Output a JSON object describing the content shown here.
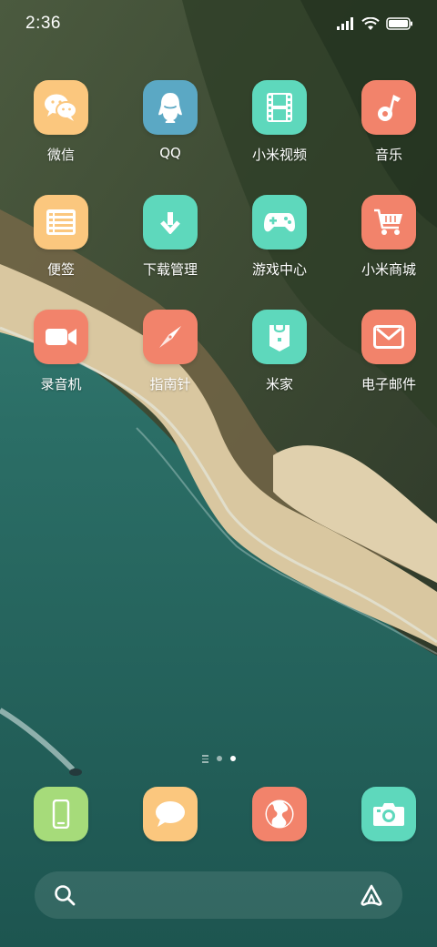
{
  "status_bar": {
    "time": "2:36",
    "icons": [
      "cellular-signal-icon",
      "wifi-icon",
      "battery-icon"
    ]
  },
  "apps": [
    [
      {
        "label": "微信",
        "icon": "wechat-icon",
        "color": "#FBC77E"
      },
      {
        "label": "QQ",
        "icon": "qq-penguin-icon",
        "color": "#5BA8C4"
      },
      {
        "label": "小米视频",
        "icon": "film-icon",
        "color": "#5ED8BC"
      },
      {
        "label": "音乐",
        "icon": "music-note-icon",
        "color": "#F2836B"
      }
    ],
    [
      {
        "label": "便签",
        "icon": "notes-list-icon",
        "color": "#FBC77E"
      },
      {
        "label": "下载管理",
        "icon": "download-arrow-icon",
        "color": "#5ED8BC"
      },
      {
        "label": "游戏中心",
        "icon": "gamepad-icon",
        "color": "#5ED8BC"
      },
      {
        "label": "小米商城",
        "icon": "shopping-cart-icon",
        "color": "#F2836B"
      }
    ],
    [
      {
        "label": "录音机",
        "icon": "recorder-icon",
        "color": "#F2836B"
      },
      {
        "label": "指南针",
        "icon": "compass-icon",
        "color": "#F2836B"
      },
      {
        "label": "米家",
        "icon": "mijia-bag-icon",
        "color": "#5ED8BC"
      },
      {
        "label": "电子邮件",
        "icon": "mail-envelope-icon",
        "color": "#F2836B"
      }
    ]
  ],
  "page_indicator": {
    "pages": 2,
    "active": 2
  },
  "dock": [
    {
      "icon": "phone-icon",
      "color": "#A6DB7A"
    },
    {
      "icon": "message-bubble-icon",
      "color": "#FBC77E"
    },
    {
      "icon": "browser-globe-icon",
      "color": "#F2836B"
    },
    {
      "icon": "camera-icon",
      "color": "#5ED8BC"
    }
  ],
  "search_bar": {
    "left_icon": "search-icon",
    "right_icon": "assistant-logo-icon"
  }
}
